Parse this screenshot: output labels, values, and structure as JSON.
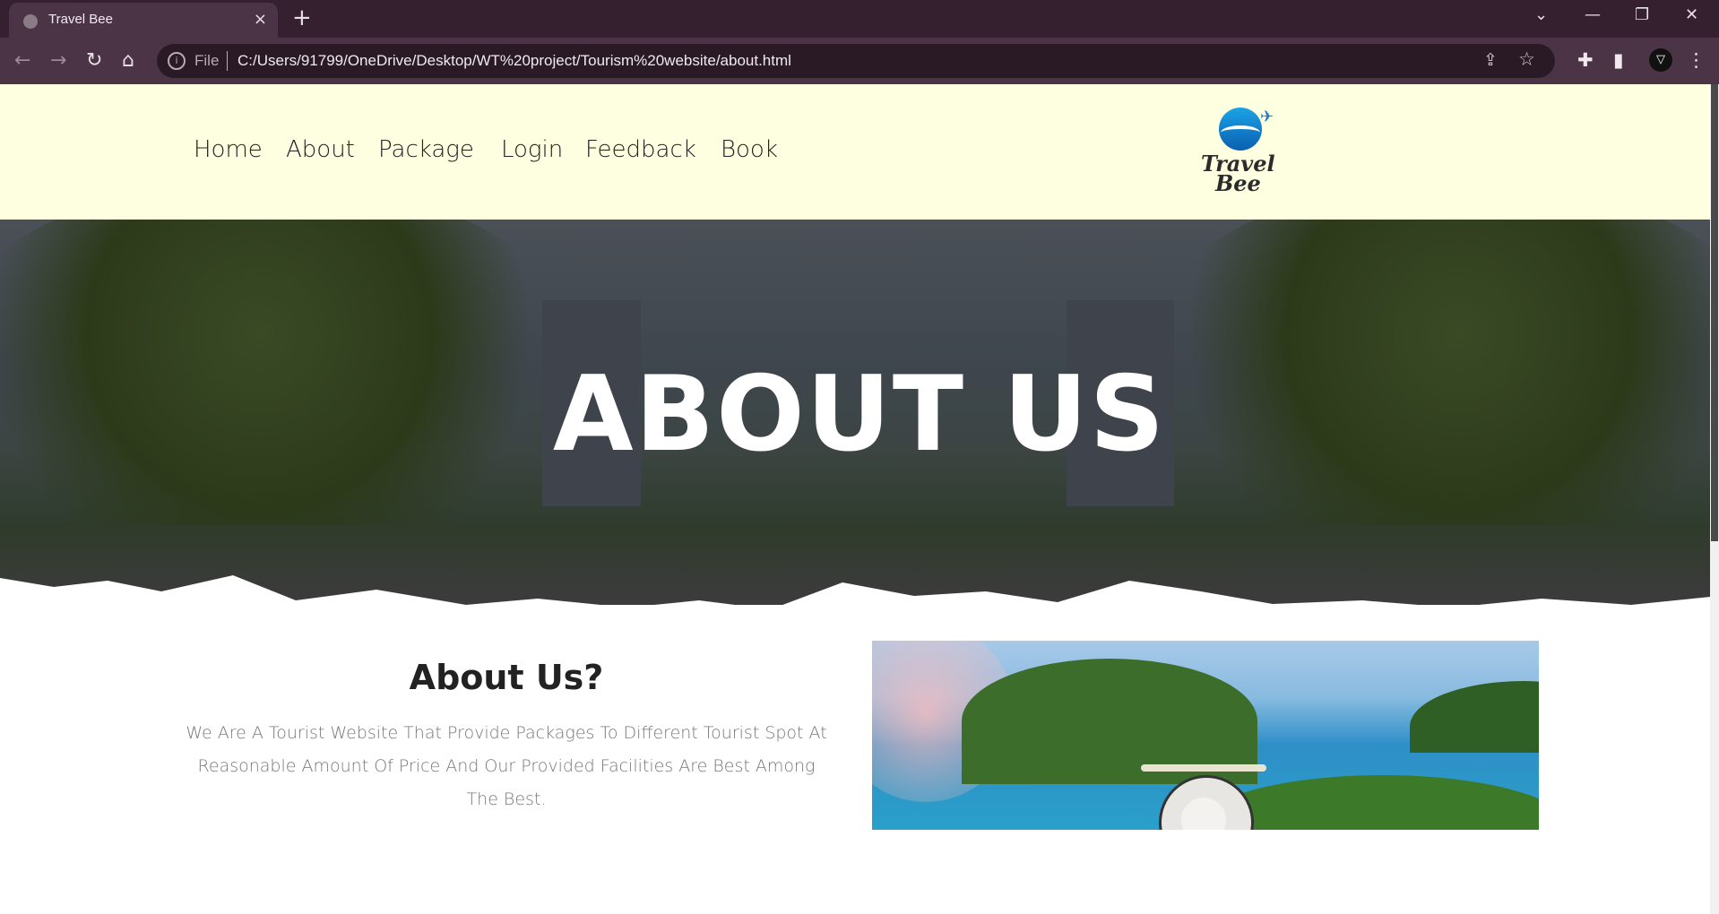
{
  "browser": {
    "tab_title": "Travel Bee",
    "tab_close": "×",
    "new_tab": "+",
    "url_scheme": "File",
    "url": "C:/Users/91799/OneDrive/Desktop/WT%20project/Tourism%20website/about.html",
    "icons": [
      "back-icon",
      "forward-icon",
      "reload-icon",
      "home-icon",
      "info-icon",
      "share-icon",
      "star-icon",
      "extensions-icon",
      "sidepanel-icon",
      "profile-icon",
      "menu-icon"
    ]
  },
  "nav": {
    "items": [
      {
        "label": "Home"
      },
      {
        "label": "About"
      },
      {
        "label": "Package"
      },
      {
        "label": "Login"
      },
      {
        "label": "Feedback"
      },
      {
        "label": "Book"
      }
    ]
  },
  "logo": {
    "line1": "Travel",
    "line2": "Bee"
  },
  "hero": {
    "title": "ABOUT US"
  },
  "about": {
    "heading": "About Us?",
    "text": "We Are A Tourist Website That Provide Packages To Different Tourist Spot At Reasonable Amount Of Price And Our Provided Facilities Are Best Among The Best."
  },
  "colors": {
    "header_bg": "#fefee0",
    "chrome_dark": "#35202f",
    "chrome_toolbar": "#4b3446"
  }
}
